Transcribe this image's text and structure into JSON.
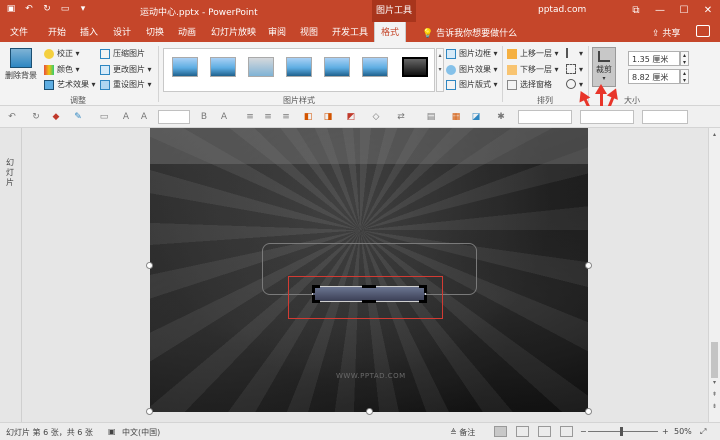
{
  "titlebar": {
    "doc_title": "运动中心.pptx - PowerPoint",
    "context_tab": "图片工具",
    "site": "pptad.com",
    "min": "—",
    "max": "☐",
    "close": "✕",
    "restore": "⧉"
  },
  "tabs": [
    "文件",
    "开始",
    "插入",
    "设计",
    "切换",
    "动画",
    "幻灯片放映",
    "审阅",
    "视图",
    "开发工具",
    "格式"
  ],
  "active_tab": "格式",
  "tellme": "告诉我你想要做什么",
  "share": "共享",
  "ribbon": {
    "remove_bg": "删除背景",
    "adjust": {
      "corrections": "校正 ▾",
      "color": "颜色 ▾",
      "artistic": "艺术效果 ▾",
      "compress": "压缩图片",
      "change": "更改图片 ▾",
      "reset": "重设图片 ▾",
      "label": "调整"
    },
    "styles": {
      "label": "图片样式",
      "border": "图片边框 ▾",
      "effects": "图片效果 ▾",
      "layout": "图片版式 ▾"
    },
    "arrange": {
      "forward": "上移一层 ▾",
      "backward": "下移一层 ▾",
      "selection": "选择窗格",
      "label": "排列"
    },
    "size": {
      "crop": "裁剪",
      "height": "1.35 厘米",
      "width": "8.82 厘米",
      "label": "大小"
    }
  },
  "left_pane": {
    "label": "幻灯片"
  },
  "slide": {
    "watermark": "WWW.PPTAD.COM"
  },
  "status": {
    "slide_info": "幻灯片 第 6 张，共 6 张",
    "language": "中文(中国)",
    "notes": "备注",
    "zoom": "50%"
  },
  "colors": {
    "accent": "#c5462a",
    "arrow": "#e8352a"
  }
}
